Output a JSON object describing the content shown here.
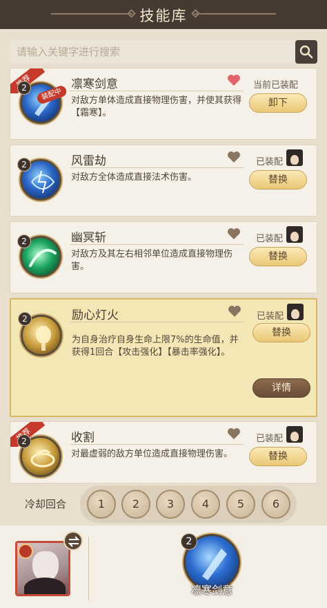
{
  "header": {
    "title": "技能库"
  },
  "search": {
    "placeholder": "请输入关键字进行搜索",
    "button_icon": "search-icon"
  },
  "skills": [
    {
      "name": "凛寒剑意",
      "level": "2",
      "recommend_badge": "推荐",
      "equipping_tag": "装配中",
      "description": "对敌方单体造成直接物理伤害，并使其获得【霜寒】。",
      "favorite": true,
      "status": "当前已装配",
      "button": "卸下",
      "icon": "ice-sword-icon"
    },
    {
      "name": "风雷劫",
      "level": "2",
      "description": "对敌方全体造成直接法术伤害。",
      "favorite": false,
      "status": "已装配",
      "button": "替换",
      "icon": "wind-thunder-icon"
    },
    {
      "name": "幽冥斩",
      "level": "2",
      "description": "对敌方及其左右相邻单位造成直接物理伤害。",
      "favorite": false,
      "status": "已装配",
      "button": "替换",
      "icon": "green-slash-icon"
    },
    {
      "name": "励心灯火",
      "level": "2",
      "description": "为自身治疗自身生命上限7%的生命值，并获得1回合【攻击强化】【暴击率强化】。",
      "favorite": false,
      "status": "已装配",
      "button": "替换",
      "detail_button": "详情",
      "icon": "lantern-icon"
    },
    {
      "name": "收割",
      "level": "2",
      "recommend_badge": "推荐",
      "description": "对最虚弱的敌方单位造成直接物理伤害。",
      "favorite": false,
      "status": "已装配",
      "button": "替换",
      "icon": "golden-ring-icon"
    }
  ],
  "cooldown": {
    "label": "冷却回合",
    "options": [
      "1",
      "2",
      "3",
      "4",
      "5",
      "6"
    ]
  },
  "equipped": {
    "skill_level": "2",
    "skill_name": "凛寒剑意"
  },
  "colors": {
    "header_bg": "#463a33",
    "accent_gold": "#e9c876",
    "badge_red": "#c63a2b",
    "selected_card": "#f4e7b6"
  }
}
